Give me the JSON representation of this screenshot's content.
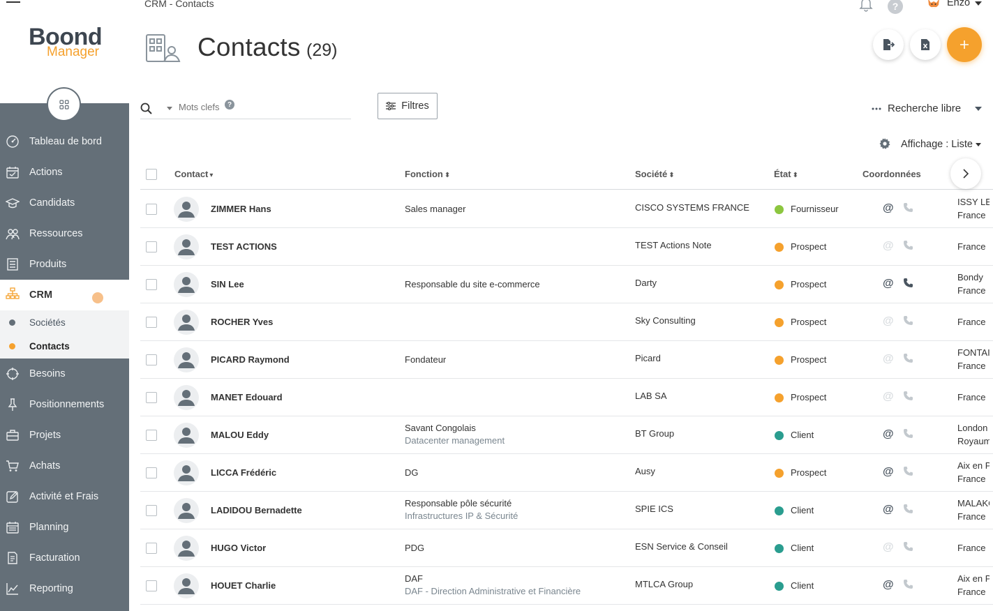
{
  "app": {
    "logo_main": "Boond",
    "logo_sub": "Manager"
  },
  "breadcrumb": "CRM - Contacts",
  "user": {
    "name": "Enzo"
  },
  "sidebar": {
    "items": [
      {
        "label": "Tableau de bord",
        "icon": "dashboard-icon"
      },
      {
        "label": "Actions",
        "icon": "calendar-check-icon"
      },
      {
        "label": "Candidats",
        "icon": "graduation-cap-icon"
      },
      {
        "label": "Ressources",
        "icon": "people-icon"
      },
      {
        "label": "Produits",
        "icon": "document-list-icon"
      }
    ],
    "crm": {
      "label": "CRM",
      "sub": [
        {
          "label": "Sociétés",
          "active": false
        },
        {
          "label": "Contacts",
          "active": true
        }
      ]
    },
    "items_after": [
      {
        "label": "Besoins",
        "icon": "target-icon"
      },
      {
        "label": "Positionnements",
        "icon": "pin-icon"
      },
      {
        "label": "Projets",
        "icon": "briefcase-icon"
      },
      {
        "label": "Achats",
        "icon": "cart-icon"
      },
      {
        "label": "Activité et Frais",
        "icon": "edit-icon"
      },
      {
        "label": "Planning",
        "icon": "calendar-icon"
      },
      {
        "label": "Facturation",
        "icon": "invoice-icon"
      },
      {
        "label": "Reporting",
        "icon": "chart-icon"
      }
    ]
  },
  "page": {
    "title": "Contacts",
    "count": "(29)"
  },
  "search": {
    "placeholder": "Mots clefs",
    "help": "?"
  },
  "filters_label": "Filtres",
  "search_mode": "Recherche libre",
  "display_mode": "Affichage : Liste",
  "columns": {
    "contact": "Contact",
    "fonction": "Fonction",
    "societe": "Société",
    "etat": "État",
    "coordonnees": "Coordonnées"
  },
  "colors": {
    "accent": "#f5a12d",
    "client": "#2a9d8f",
    "fournisseur": "#8cc63f",
    "prospect": "#f5a12d"
  },
  "contacts": [
    {
      "name": "ZIMMER Hans",
      "function": "Sales manager",
      "function2": "",
      "company": "CISCO SYSTEMS FRANCE",
      "state": "Fournisseur",
      "state_color": "#8cc63f",
      "email": true,
      "phone": false,
      "addr1": "ISSY LE",
      "addr2": "France"
    },
    {
      "name": "TEST ACTIONS",
      "function": "",
      "function2": "",
      "company": "TEST Actions Note",
      "state": "Prospect",
      "state_color": "#f5a12d",
      "email": false,
      "phone": false,
      "addr1": "",
      "addr2": "France"
    },
    {
      "name": "SIN Lee",
      "function": "Responsable du site e-commerce",
      "function2": "",
      "company": "Darty",
      "state": "Prospect",
      "state_color": "#f5a12d",
      "email": true,
      "phone": true,
      "addr1": "Bondy",
      "addr2": "France"
    },
    {
      "name": "ROCHER Yves",
      "function": "",
      "function2": "",
      "company": "Sky Consulting",
      "state": "Prospect",
      "state_color": "#f5a12d",
      "email": false,
      "phone": false,
      "addr1": "",
      "addr2": "France"
    },
    {
      "name": "PICARD Raymond",
      "function": "Fondateur",
      "function2": "",
      "company": "Picard",
      "state": "Prospect",
      "state_color": "#f5a12d",
      "email": false,
      "phone": false,
      "addr1": "FONTAI",
      "addr2": "France"
    },
    {
      "name": "MANET Edouard",
      "function": "",
      "function2": "",
      "company": "LAB SA",
      "state": "Prospect",
      "state_color": "#f5a12d",
      "email": false,
      "phone": false,
      "addr1": "",
      "addr2": "France"
    },
    {
      "name": "MALOU Eddy",
      "function": "Savant Congolais",
      "function2": "Datacenter management",
      "company": "BT Group",
      "state": "Client",
      "state_color": "#2a9d8f",
      "email": true,
      "phone": false,
      "addr1": "London",
      "addr2": "Royaum"
    },
    {
      "name": "LICCA Frédéric",
      "function": "DG",
      "function2": "",
      "company": "Ausy",
      "state": "Prospect",
      "state_color": "#f5a12d",
      "email": true,
      "phone": false,
      "addr1": "Aix en P",
      "addr2": "France"
    },
    {
      "name": "LADIDOU Bernadette",
      "function": "Responsable pôle sécurité",
      "function2": "Infrastructures IP & Sécurité",
      "company": "SPIE ICS",
      "state": "Client",
      "state_color": "#2a9d8f",
      "email": true,
      "phone": false,
      "addr1": "MALAKO",
      "addr2": "France"
    },
    {
      "name": "HUGO Victor",
      "function": "PDG",
      "function2": "",
      "company": "ESN Service & Conseil",
      "state": "Client",
      "state_color": "#2a9d8f",
      "email": false,
      "phone": false,
      "addr1": "",
      "addr2": "France"
    },
    {
      "name": "HOUET Charlie",
      "function": "DAF",
      "function2": "DAF - Direction Administrative et Financière",
      "company": "MTLCA Group",
      "state": "Client",
      "state_color": "#2a9d8f",
      "email": true,
      "phone": false,
      "addr1": "Aix en P",
      "addr2": "France"
    }
  ]
}
